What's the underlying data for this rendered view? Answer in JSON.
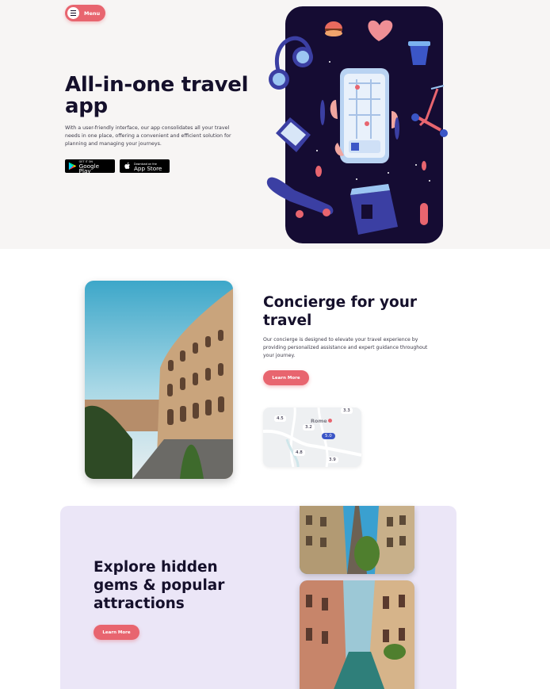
{
  "header": {
    "menu_label": "Menu"
  },
  "hero": {
    "title": "All-in-one travel app",
    "description": "With a user-friendly interface, our app consolidates all your travel needs in one place, offering a convenient and efficient solution for planning and managing your journeys.",
    "google_play": {
      "small": "GET IT ON",
      "big": "Google Play"
    },
    "app_store": {
      "small": "Download on the",
      "big": "App Store"
    }
  },
  "concierge": {
    "title": "Concierge for your travel",
    "description": "Our concierge is designed to elevate your travel experience by providing personalized assistance and expert guidance throughout your journey.",
    "button_label": "Learn More",
    "map": {
      "city": "Rome",
      "ratings": [
        "4.5",
        "3.2",
        "4.8",
        "3.9",
        "3.3"
      ],
      "selected": "5.0"
    }
  },
  "explore": {
    "title": "Explore hidden gems & popular attractions",
    "button_label": "Learn More"
  },
  "colors": {
    "accent": "#e8656f",
    "dark": "#15102b",
    "hero_bg": "#f7f5f4",
    "lavender": "#ebe6f7"
  }
}
